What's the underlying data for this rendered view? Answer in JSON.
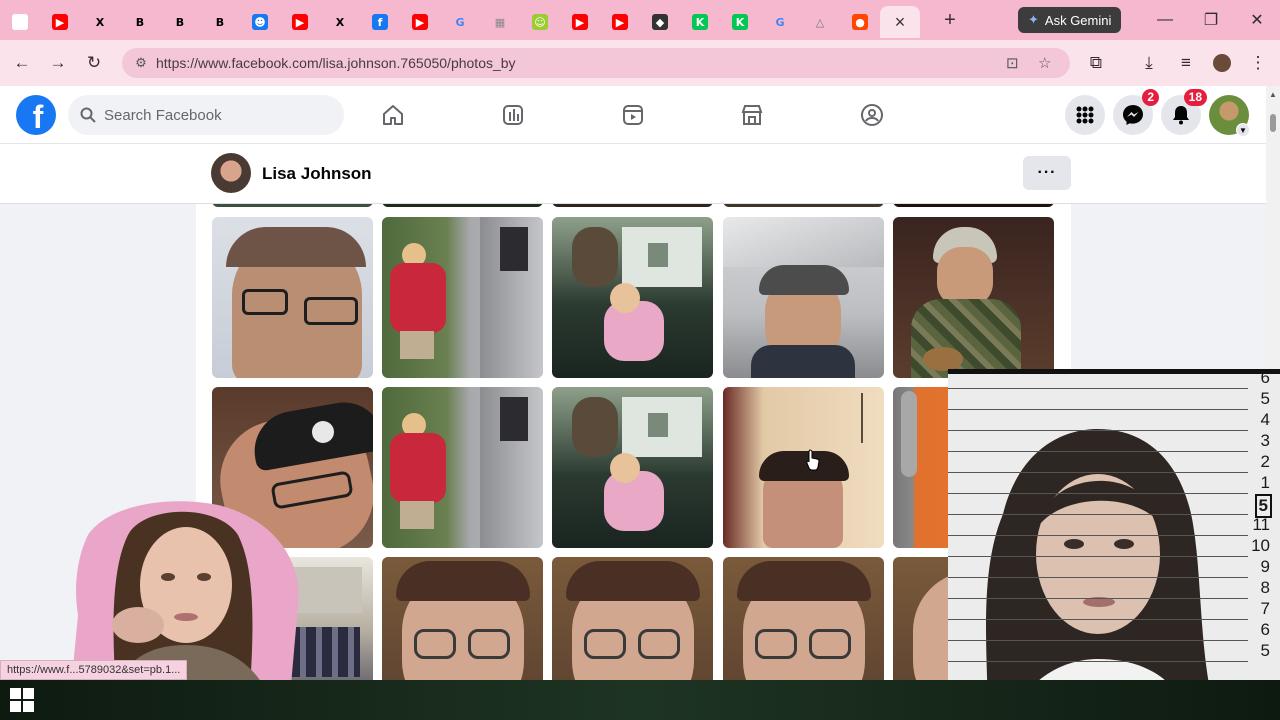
{
  "browser": {
    "tabs": [
      {
        "icon": "ghost-icon",
        "color": "#ffffff"
      },
      {
        "icon": "youtube-icon",
        "color": "#ff0000"
      },
      {
        "icon": "x-icon",
        "color": "#000000"
      },
      {
        "icon": "bold-b-icon",
        "color": "#000000"
      },
      {
        "icon": "bold-b-icon",
        "color": "#000000"
      },
      {
        "icon": "bold-b-icon",
        "color": "#000000"
      },
      {
        "icon": "mask-icon",
        "color": "#1877f2"
      },
      {
        "icon": "youtube-icon",
        "color": "#ff0000"
      },
      {
        "icon": "x-icon",
        "color": "#000000"
      },
      {
        "icon": "facebook-icon",
        "color": "#1877f2"
      },
      {
        "icon": "youtube-icon",
        "color": "#ff0000"
      },
      {
        "icon": "google-icon",
        "color": "#4285f4"
      },
      {
        "icon": "grid-icon",
        "color": "#888888"
      },
      {
        "icon": "monster-icon",
        "color": "#9acd32"
      },
      {
        "icon": "youtube-icon",
        "color": "#ff0000"
      },
      {
        "icon": "youtube-icon",
        "color": "#ff0000"
      },
      {
        "icon": "animal-icon",
        "color": "#333333"
      },
      {
        "icon": "k-icon",
        "color": "#00c853"
      },
      {
        "icon": "k-icon",
        "color": "#00c853"
      },
      {
        "icon": "google-icon",
        "color": "#4285f4"
      },
      {
        "icon": "triangle-icon",
        "color": "#777777"
      },
      {
        "icon": "reddit-icon",
        "color": "#ff4500"
      }
    ],
    "active_tab_close": "×",
    "new_tab": "+",
    "ask_gemini": "Ask Gemini",
    "url": "https://www.facebook.com/lisa.johnson.765050/photos_by",
    "status_url": "https://www.f...5789032&set=pb.1..."
  },
  "facebook": {
    "search_placeholder": "Search Facebook",
    "messenger_badge": "2",
    "notifications_badge": "18",
    "profile_name": "Lisa Johnson",
    "more_label": "···"
  },
  "mugshot": {
    "ruler_marks": [
      "6",
      "5",
      "4",
      "3",
      "2",
      "1",
      "5",
      "11",
      "10",
      "9",
      "8",
      "7",
      "6",
      "5"
    ]
  },
  "colors": {
    "tab_strip": "#f6b8cf",
    "toolbar": "#fbe3ec",
    "facebook_blue": "#1877f2",
    "badge_red": "#e41e3f"
  }
}
